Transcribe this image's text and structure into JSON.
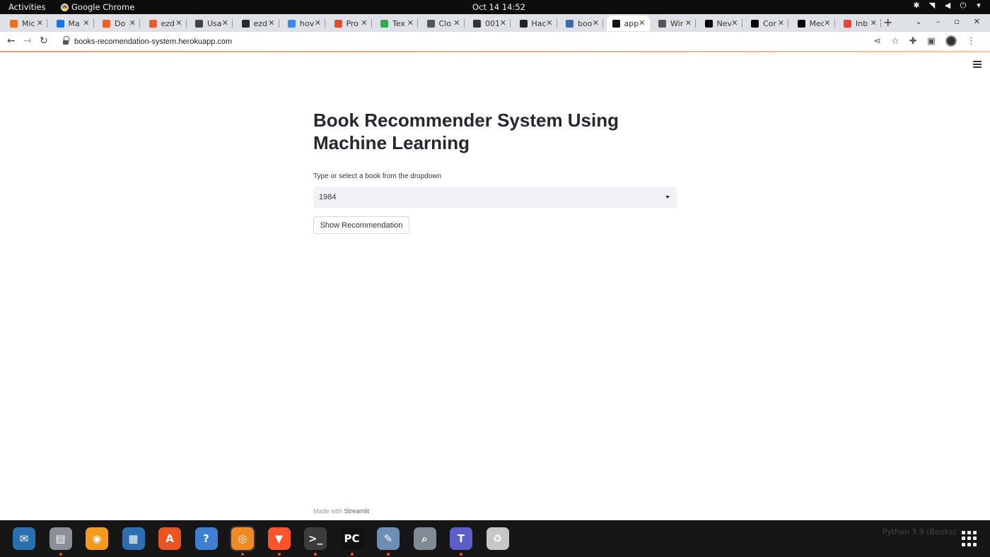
{
  "system": {
    "activities": "Activities",
    "app_name": "Google Chrome",
    "clock": "Oct 14  14:52"
  },
  "tabs": [
    {
      "title": "Mic",
      "color": "#e8711c"
    },
    {
      "title": "Ma",
      "color": "#1a73e8"
    },
    {
      "title": "Do",
      "color": "#ff5a1f"
    },
    {
      "title": "ezd",
      "color": "#f05a28"
    },
    {
      "title": "Usa",
      "color": "#444444"
    },
    {
      "title": "ezd",
      "color": "#24292e"
    },
    {
      "title": "hov",
      "color": "#4285f4"
    },
    {
      "title": "Pro",
      "color": "#e44d26"
    },
    {
      "title": "Tex",
      "color": "#34a853"
    },
    {
      "title": "Clo",
      "color": "#555555"
    },
    {
      "title": "001",
      "color": "#333333"
    },
    {
      "title": "Hac",
      "color": "#222222"
    },
    {
      "title": "boo",
      "color": "#3b6ea5"
    },
    {
      "title": "app",
      "color": "#111111",
      "active": true
    },
    {
      "title": "Wir",
      "color": "#555555"
    },
    {
      "title": "Nev",
      "color": "#000000"
    },
    {
      "title": "Cor",
      "color": "#000000"
    },
    {
      "title": "Mec",
      "color": "#000000"
    },
    {
      "title": "Inb",
      "color": "#ea4335"
    }
  ],
  "browser": {
    "url": "books-recomendation-system.herokuapp.com"
  },
  "page": {
    "title": "Book Recommender System Using Machine Learning",
    "select_label": "Type or select a book from the dropdown",
    "select_value": "1984",
    "button_label": "Show Recommendation",
    "footer_prefix": "Made with",
    "footer_brand": "Streamlit"
  },
  "dock": {
    "apps": [
      {
        "name": "thunderbird",
        "label": "✉",
        "bg": "#2a6fb0",
        "running": false
      },
      {
        "name": "files",
        "label": "▤",
        "bg": "#8a8f95",
        "running": true
      },
      {
        "name": "rhythmbox",
        "label": "◉",
        "bg": "#f29a1c",
        "running": false
      },
      {
        "name": "writer",
        "label": "▦",
        "bg": "#2c6db3",
        "running": false
      },
      {
        "name": "software",
        "label": "A",
        "bg": "#e95420",
        "running": false
      },
      {
        "name": "help",
        "label": "?",
        "bg": "#3f7fcf",
        "running": false
      },
      {
        "name": "chrome",
        "label": "◎",
        "bg": "#f08a24",
        "running": true,
        "highlight": true
      },
      {
        "name": "brave",
        "label": "▼",
        "bg": "#fb542b",
        "running": true
      },
      {
        "name": "terminal",
        "label": ">_",
        "bg": "#3c3c3c",
        "running": true
      },
      {
        "name": "pycharm",
        "label": "PC",
        "bg": "#111111",
        "running": true
      },
      {
        "name": "text-editor",
        "label": "✎",
        "bg": "#6d8fb5",
        "running": true
      },
      {
        "name": "magnifier",
        "label": "⌕",
        "bg": "#7e8a94",
        "running": false
      },
      {
        "name": "teams",
        "label": "T",
        "bg": "#5b5fc7",
        "running": true
      },
      {
        "name": "trash",
        "label": "♻",
        "bg": "#c7c7c7",
        "running": false
      }
    ],
    "background_text": "Python 3.9 (Books)"
  }
}
